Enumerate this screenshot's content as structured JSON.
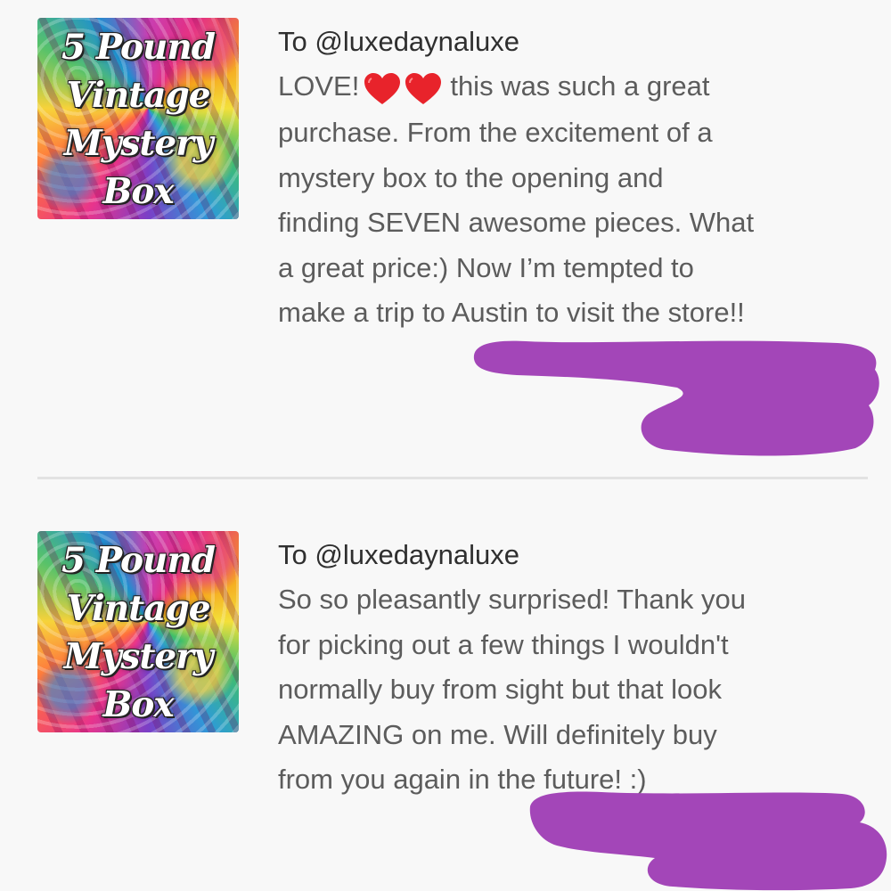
{
  "reviews": [
    {
      "thumbnail": {
        "logo_lines": [
          "5 Pound",
          "Vintage",
          "Mystery",
          "Box"
        ]
      },
      "recipient": "To @luxedaynaluxe",
      "lines": [
        {
          "before": "LOVE!",
          "after": "this was such a great"
        },
        "purchase. From the excitement of a",
        "mystery box to the opening and",
        "finding SEVEN awesome pieces. What",
        "a great price:) Now I’m tempted to",
        "make a trip to Austin to visit the store!!"
      ],
      "emoji": "heart-emoji"
    },
    {
      "thumbnail": {
        "logo_lines": [
          "5 Pound",
          "Vintage",
          "Mystery",
          "Box"
        ]
      },
      "recipient": "To @luxedaynaluxe",
      "lines": [
        "So so pleasantly surprised! Thank you",
        "for picking out a few things I wouldn't",
        "normally buy from sight but that look",
        "AMAZING on me. Will definitely buy",
        "from you again in the future! :)"
      ]
    }
  ],
  "colors": {
    "background": "#f8f8f8",
    "text": "#5c5c5c",
    "recipient": "#2f2f2f",
    "divider": "#e2e2e2",
    "redaction": "#a346b8",
    "heart": "#e8232b"
  }
}
